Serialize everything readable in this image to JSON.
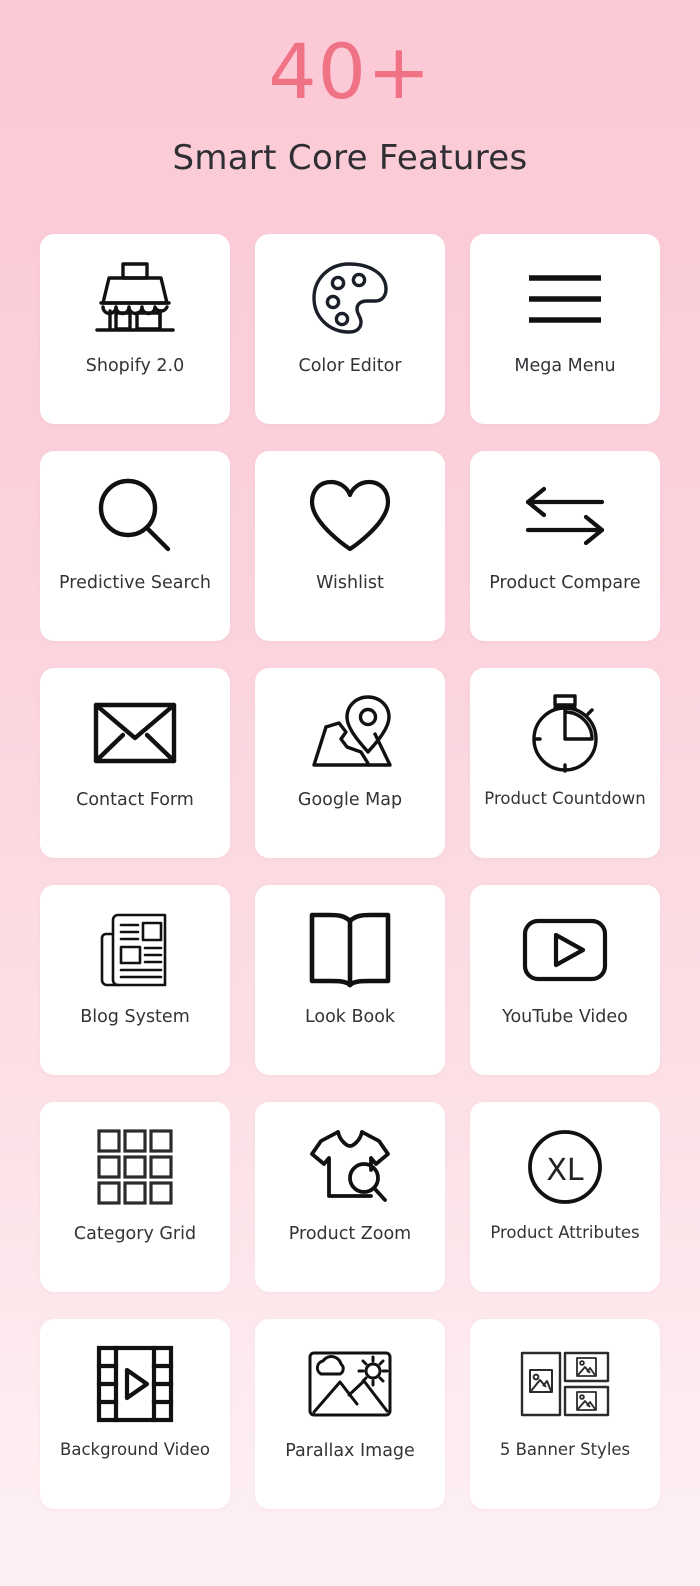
{
  "header": {
    "count": "40+",
    "subtitle": "Smart Core Features",
    "accent_color": "#ef7285",
    "text_color": "#2e2e33"
  },
  "theme": {
    "background_top": "#fbc9d5",
    "background_bottom": "#fdf0f3",
    "card_background": "#ffffff",
    "icon_color": "#111111"
  },
  "features": [
    {
      "label": "Shopify 2.0",
      "icon": "storefront-icon"
    },
    {
      "label": "Color Editor",
      "icon": "palette-icon"
    },
    {
      "label": "Mega Menu",
      "icon": "hamburger-menu-icon"
    },
    {
      "label": "Predictive Search",
      "icon": "magnifier-icon"
    },
    {
      "label": "Wishlist",
      "icon": "heart-icon"
    },
    {
      "label": "Product Compare",
      "icon": "compare-arrows-icon"
    },
    {
      "label": "Contact Form",
      "icon": "envelope-icon"
    },
    {
      "label": "Google Map",
      "icon": "map-pin-icon"
    },
    {
      "label": "Product Countdown",
      "icon": "stopwatch-icon"
    },
    {
      "label": "Blog System",
      "icon": "newspaper-icon"
    },
    {
      "label": "Look Book",
      "icon": "open-book-icon"
    },
    {
      "label": "YouTube Video",
      "icon": "video-play-icon"
    },
    {
      "label": "Category Grid",
      "icon": "grid-3x3-icon"
    },
    {
      "label": "Product Zoom",
      "icon": "tshirt-zoom-icon"
    },
    {
      "label": "Product Attributes",
      "icon": "size-xl-circle-icon"
    },
    {
      "label": "Background Video",
      "icon": "film-strip-play-icon"
    },
    {
      "label": "Parallax Image",
      "icon": "landscape-photo-icon"
    },
    {
      "label": "5 Banner Styles",
      "icon": "banner-layout-icon"
    }
  ]
}
